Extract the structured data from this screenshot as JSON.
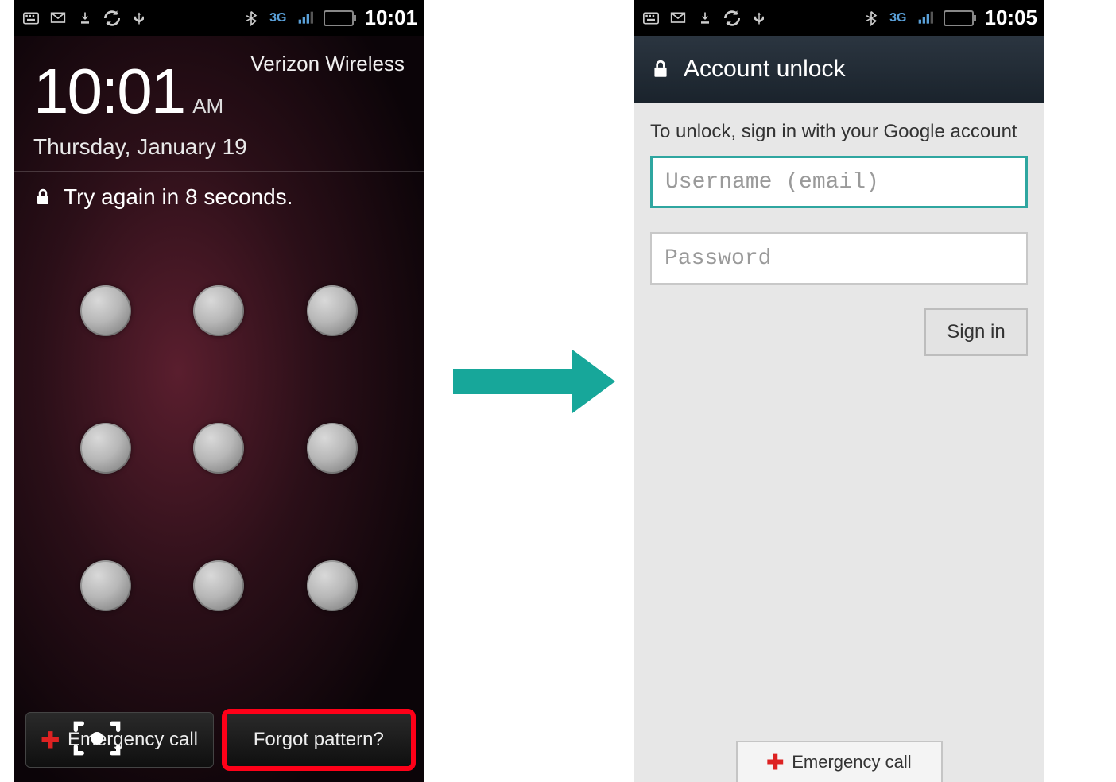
{
  "left": {
    "status_time": "10:01",
    "carrier": "Verizon Wireless",
    "clock": "10:01",
    "ampm": "AM",
    "date": "Thursday, January 19",
    "try_again": "Try again in 8 seconds.",
    "emergency_call": "Emergency call",
    "forgot_pattern": "Forgot pattern?"
  },
  "right": {
    "status_time": "10:05",
    "title": "Account unlock",
    "instruction": "To unlock, sign in with your Google account",
    "username_placeholder": "Username (email)",
    "password_placeholder": "Password",
    "signin": "Sign in",
    "emergency_call": "Emergency call"
  },
  "network_label": "3G"
}
